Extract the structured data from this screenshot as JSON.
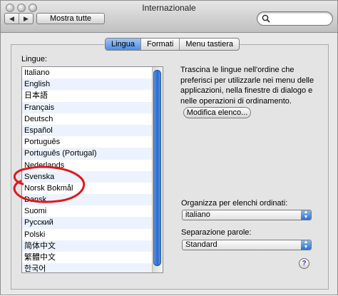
{
  "window": {
    "title": "Internazionale"
  },
  "toolbar": {
    "back_glyph": "◀",
    "forward_glyph": "▶",
    "show_all_label": "Mostra tutte",
    "search_value": ""
  },
  "tabs": [
    {
      "label": "Lingua",
      "active": true
    },
    {
      "label": "Formati",
      "active": false
    },
    {
      "label": "Menu tastiera",
      "active": false
    }
  ],
  "languages": {
    "label": "Lingue:",
    "items": [
      "Italiano",
      "English",
      "日本語",
      "Français",
      "Deutsch",
      "Español",
      "Português",
      "Português (Portugal)",
      "Nederlands",
      "Svenska",
      "Norsk Bokmål",
      "Dansk",
      "Suomi",
      "Русский",
      "Polski",
      "简体中文",
      "繁體中文",
      "한국어"
    ]
  },
  "description": "Trascina le lingue nell'ordine che preferisci per utilizzarle nei menu delle applicazioni, nella finestre di dialogo e nelle operazioni di ordinamento.",
  "edit_list_button": "Modifica elenco...",
  "sort_order": {
    "label": "Organizza per elenchi ordinati:",
    "value": "italiano"
  },
  "word_break": {
    "label": "Separazione parole:",
    "value": "Standard"
  },
  "help_glyph": "?",
  "colors": {
    "accent": "#3a7bd5",
    "annotation": "#e0191c"
  },
  "icons": [
    "search-icon",
    "back-arrow-icon",
    "forward-arrow-icon",
    "help-icon",
    "popup-arrows-icon"
  ]
}
